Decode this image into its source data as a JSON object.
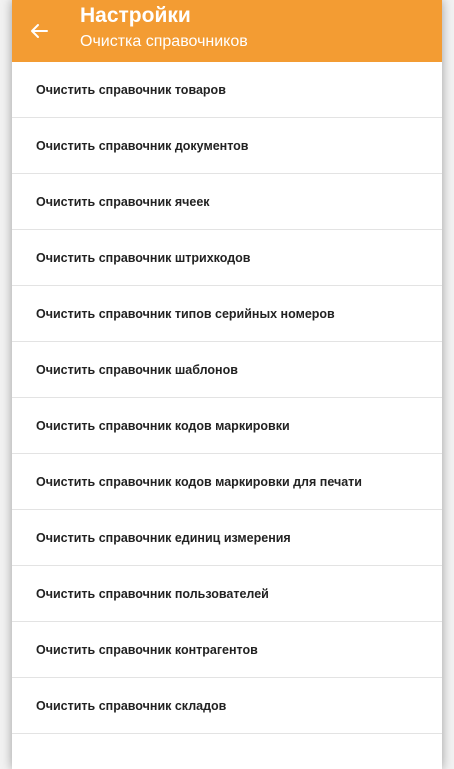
{
  "header": {
    "title": "Настройки",
    "subtitle": "Очистка справочников",
    "back_icon": "arrow-left-icon",
    "background_color": "#f39c33",
    "text_color": "#ffffff"
  },
  "items": [
    {
      "label": "Очистить справочник товаров"
    },
    {
      "label": "Очистить справочник документов"
    },
    {
      "label": "Очистить справочник ячеек"
    },
    {
      "label": "Очистить справочник штрихкодов"
    },
    {
      "label": "Очистить справочник типов серийных номеров"
    },
    {
      "label": "Очистить справочник шаблонов"
    },
    {
      "label": "Очистить справочник кодов маркировки"
    },
    {
      "label": "Очистить справочник кодов маркировки для печати"
    },
    {
      "label": "Очистить справочник единиц измерения"
    },
    {
      "label": "Очистить справочник пользователей"
    },
    {
      "label": "Очистить справочник контрагентов"
    },
    {
      "label": "Очистить справочник складов"
    },
    {
      "label": ""
    }
  ]
}
